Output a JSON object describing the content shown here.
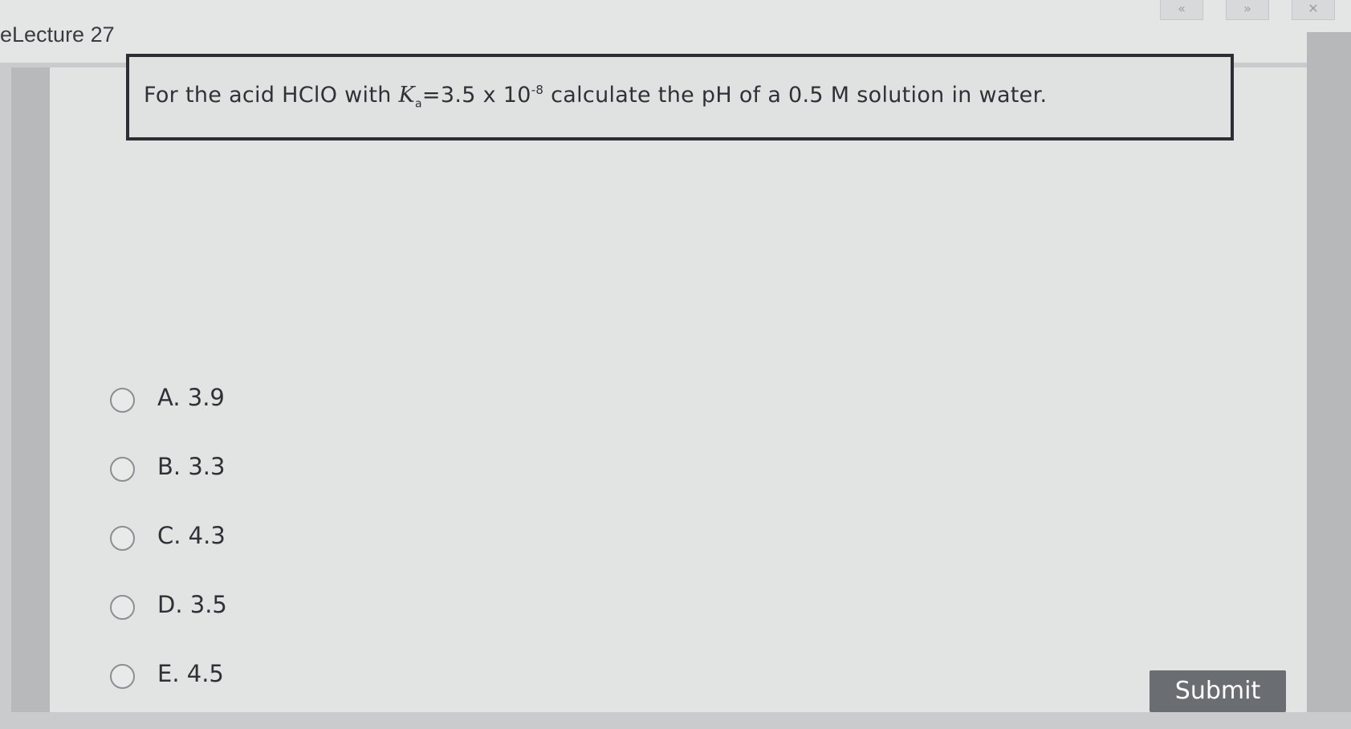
{
  "header": {
    "lecture_title": "eLecture 27",
    "controls": [
      {
        "icon": "rewind-icon",
        "glyph": "«"
      },
      {
        "icon": "fast-forward-icon",
        "glyph": "»"
      },
      {
        "icon": "close-icon",
        "glyph": "✕"
      }
    ]
  },
  "question": {
    "prefix": "For the acid HClO with ",
    "k_symbol": "K",
    "k_subscript": "a",
    "equals_value": "=3.5 x 10",
    "exponent": "-8",
    "suffix": " calculate the pH of a 0.5 M solution in water."
  },
  "options": [
    {
      "label": "A. 3.9"
    },
    {
      "label": "B. 3.3"
    },
    {
      "label": "C. 4.3"
    },
    {
      "label": "D. 3.5"
    },
    {
      "label": "E. 4.5"
    }
  ],
  "submit_label": "Submit"
}
